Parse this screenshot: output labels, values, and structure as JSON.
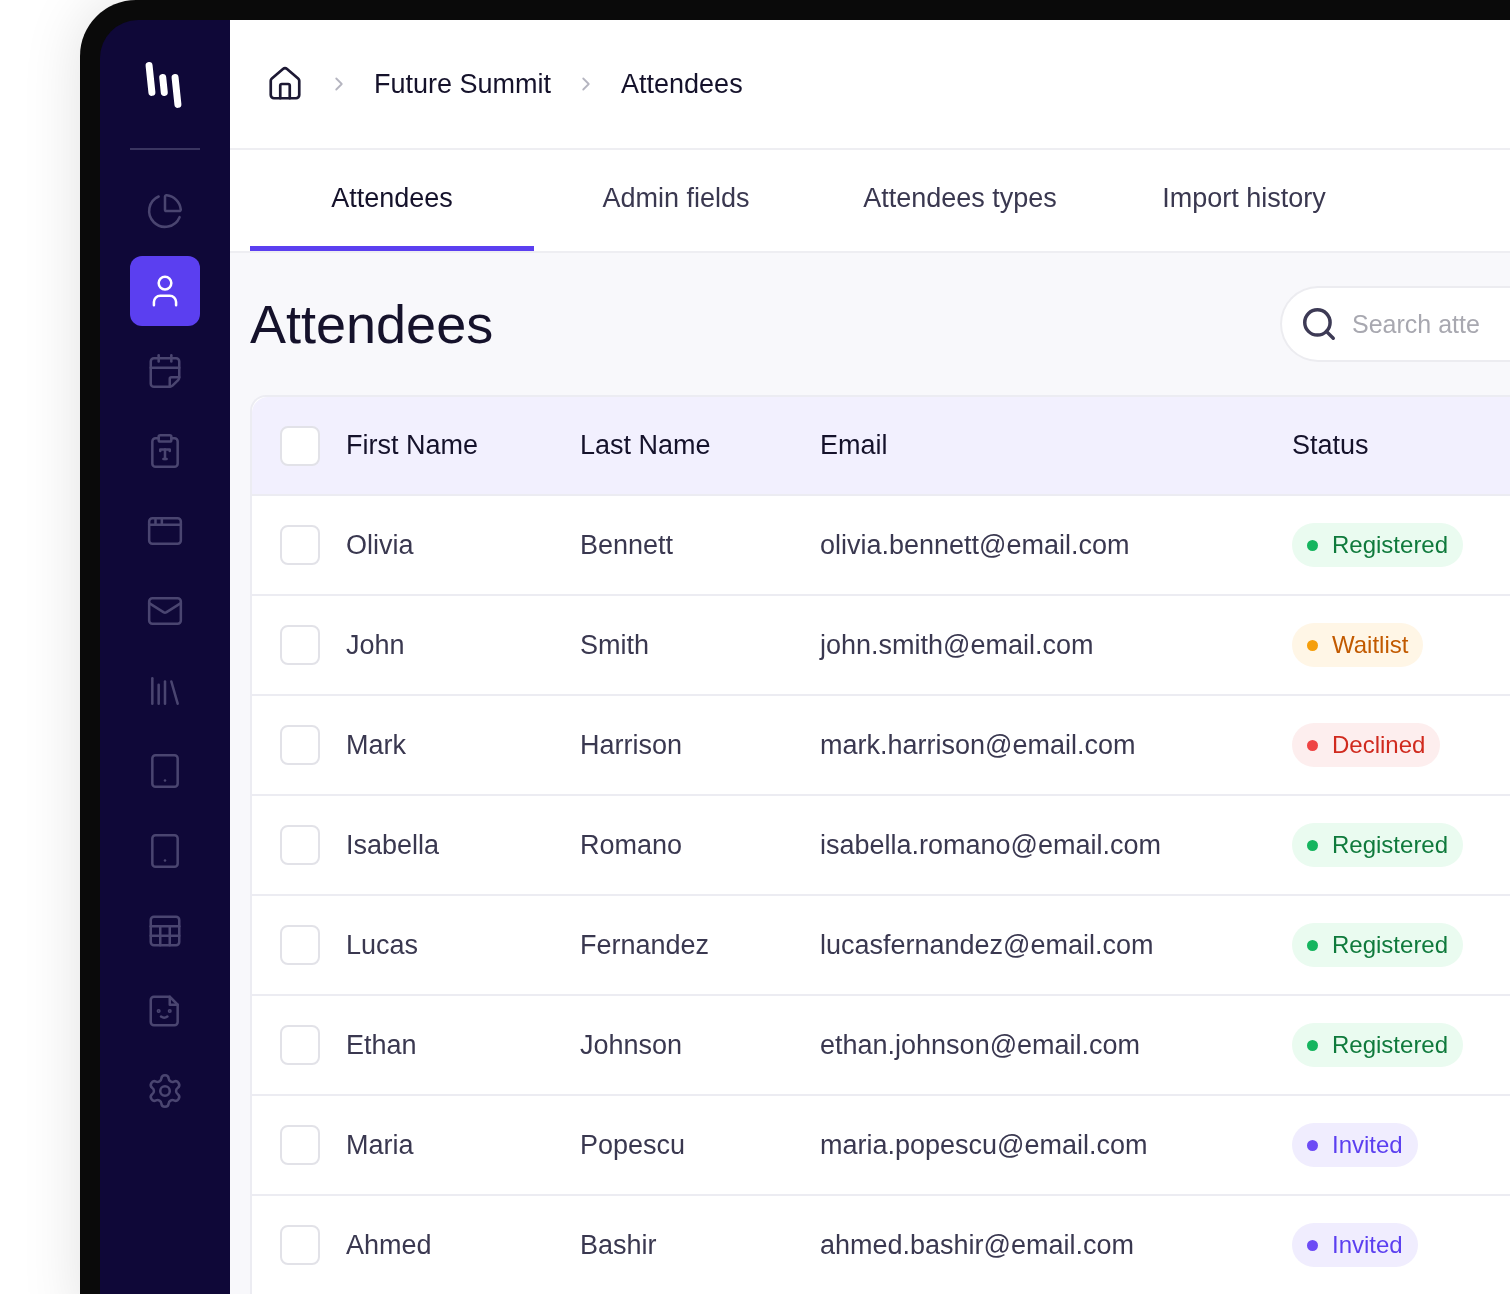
{
  "sidebar": {
    "items": [
      {
        "selected": false
      },
      {
        "selected": true
      },
      {
        "selected": false
      },
      {
        "selected": false
      },
      {
        "selected": false
      },
      {
        "selected": false
      },
      {
        "selected": false
      },
      {
        "selected": false
      },
      {
        "selected": false
      },
      {
        "selected": false
      },
      {
        "selected": false
      },
      {
        "selected": false
      }
    ]
  },
  "breadcrumb": [
    "Future Summit",
    "Attendees"
  ],
  "tabs": [
    {
      "label": "Attendees",
      "selected": true
    },
    {
      "label": "Admin fields",
      "selected": false
    },
    {
      "label": "Attendees types",
      "selected": false
    },
    {
      "label": "Import history",
      "selected": false
    }
  ],
  "page_title": "Attendees",
  "search": {
    "placeholder": "Search atte"
  },
  "table": {
    "select_all": {
      "checked": false
    },
    "columns": [
      "First Name",
      "Last Name",
      "Email",
      "Status"
    ],
    "rows": [
      {
        "checked": false,
        "first_name": "Olivia",
        "last_name": "Bennett",
        "email": "olivia.bennett@email.com",
        "status": {
          "label": "Registered",
          "kind": "registered"
        }
      },
      {
        "checked": false,
        "first_name": "John",
        "last_name": "Smith",
        "email": "john.smith@email.com",
        "status": {
          "label": "Waitlist",
          "kind": "waitlist"
        }
      },
      {
        "checked": false,
        "first_name": "Mark",
        "last_name": "Harrison",
        "email": "mark.harrison@email.com",
        "status": {
          "label": "Declined",
          "kind": "declined"
        }
      },
      {
        "checked": false,
        "first_name": "Isabella",
        "last_name": "Romano",
        "email": "isabella.romano@email.com",
        "status": {
          "label": "Registered",
          "kind": "registered"
        }
      },
      {
        "checked": false,
        "first_name": "Lucas",
        "last_name": "Fernandez",
        "email": "lucasfernandez@email.com",
        "status": {
          "label": "Registered",
          "kind": "registered"
        }
      },
      {
        "checked": false,
        "first_name": "Ethan",
        "last_name": "Johnson",
        "email": "ethan.johnson@email.com",
        "status": {
          "label": "Registered",
          "kind": "registered"
        }
      },
      {
        "checked": false,
        "first_name": "Maria",
        "last_name": "Popescu",
        "email": "maria.popescu@email.com",
        "status": {
          "label": "Invited",
          "kind": "invited"
        }
      },
      {
        "checked": false,
        "first_name": "Ahmed",
        "last_name": "Bashir",
        "email": "ahmed.bashir@email.com",
        "status": {
          "label": "Invited",
          "kind": "invited"
        }
      }
    ]
  }
}
